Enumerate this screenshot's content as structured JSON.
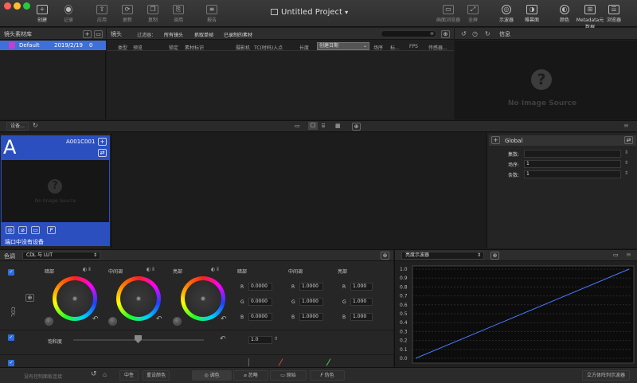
{
  "toolbar": {
    "title": "Untitled Project",
    "buttons": [
      "创建",
      "记录",
      "应用",
      "更新",
      "复制",
      "调用",
      "报告",
      "画面浏览器",
      "全屏",
      "示波器",
      "帷幕面",
      "颜色",
      "Metadata元数据",
      "浏览器"
    ]
  },
  "library": {
    "header": "镜头素材库",
    "item": {
      "name": "Default",
      "date": "2019/2/19",
      "count": "0"
    },
    "device_button": "设备..."
  },
  "shots": {
    "label": "镜头",
    "filter_label": "过滤器：",
    "filters": [
      "所有镜头",
      "抓取单帧",
      "已录制的素材"
    ],
    "columns": [
      "类型",
      "预览",
      "锁定",
      "素材标识",
      "摄影机",
      "TC(时码)入点",
      "长度",
      "创建日期",
      "场序",
      "标...",
      "FPS",
      "传感器..."
    ]
  },
  "viewer": {
    "info_label": "信息",
    "no_image": "No Image Source"
  },
  "device": {
    "letter": "A",
    "id": "A001C001",
    "no_image": "No Image Source",
    "status": "端口中没有设备",
    "f_label": "F"
  },
  "global": {
    "title": "Global",
    "rows": [
      {
        "label": "集数:",
        "value": ""
      },
      {
        "label": "场序:",
        "value": "1"
      },
      {
        "label": "条数:",
        "value": "1"
      }
    ]
  },
  "color": {
    "tab": "色调",
    "mode": "CDL 与 LUT",
    "wheels": [
      "暗部",
      "中间调",
      "亮部"
    ],
    "rgb_headers": [
      "暗部",
      "中间调",
      "亮部"
    ],
    "channels": [
      "R",
      "G",
      "B"
    ],
    "values": [
      "0.0000",
      "1.0000",
      "1.000"
    ],
    "cdl_label": "CDL",
    "saturation_label": "饱和度",
    "saturation_value": "1.0"
  },
  "scope": {
    "mode": "亮度示波器",
    "yticks": [
      "1.0",
      "0.9",
      "0.8",
      "0.7",
      "0.6",
      "0.5",
      "0.4",
      "0.3",
      "0.2",
      "0.1",
      "0.0"
    ],
    "chart_data": {
      "type": "line",
      "x": [
        0,
        1
      ],
      "y": [
        0,
        1
      ],
      "ylim": [
        0,
        1
      ]
    }
  },
  "bottom": {
    "hint": "没有控制面板连接",
    "neutral": "中性",
    "reset": "重设颜色",
    "tabs": [
      "调色",
      "忽略",
      "原始",
      "伪色"
    ],
    "stacked_scopes": "立方体阵列示波器"
  },
  "colors": {
    "accent": "#2b4fbf",
    "select": "#3f6fd8"
  }
}
